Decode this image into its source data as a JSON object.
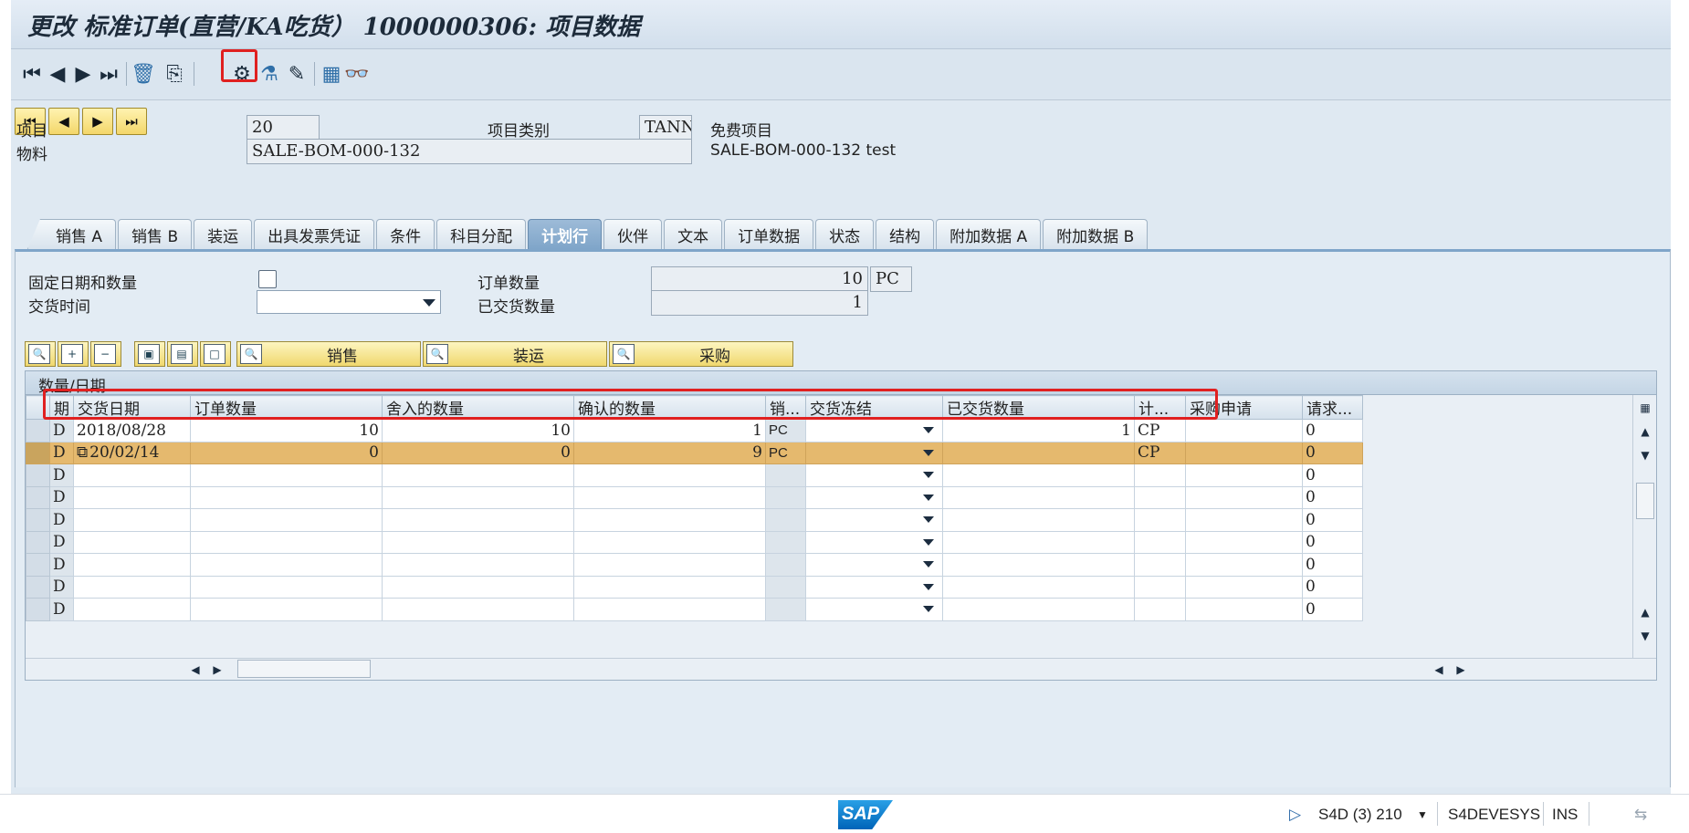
{
  "window": {
    "title": "更改 标准订单(直营/KA吃货） 1000000306: 项目数据"
  },
  "toolbar": {
    "buttons": [
      {
        "name": "first-icon",
        "glyph": "⏮"
      },
      {
        "name": "previous-icon",
        "glyph": "◀"
      },
      {
        "name": "next-icon",
        "glyph": "▶"
      },
      {
        "name": "last-icon",
        "glyph": "⏭"
      },
      {
        "name": "delete-icon",
        "glyph": "🗑"
      },
      {
        "name": "copy-icon",
        "glyph": "⎘"
      },
      {
        "name": "configuration-icon",
        "glyph": "⚙"
      },
      {
        "name": "test-icon",
        "glyph": "⚗"
      },
      {
        "name": "edit-icon",
        "glyph": "✎"
      },
      {
        "name": "calculator-icon",
        "glyph": "▦"
      },
      {
        "name": "display-icon",
        "glyph": "👓"
      }
    ]
  },
  "item_nav": [
    "⏮",
    "◀",
    "▶",
    "⏭"
  ],
  "header": {
    "item_label": "项目",
    "item_value": "20",
    "item_category_label": "项目类别",
    "item_category_value": "TANN",
    "item_category_text": "免费项目",
    "material_label": "物料",
    "material_value": "SALE-BOM-000-132",
    "material_text": "SALE-BOM-000-132 test"
  },
  "tabs": [
    {
      "label": "销售 A",
      "active": false
    },
    {
      "label": "销售 B",
      "active": false
    },
    {
      "label": "装运",
      "active": false
    },
    {
      "label": "出具发票凭证",
      "active": false
    },
    {
      "label": "条件",
      "active": false
    },
    {
      "label": "科目分配",
      "active": false
    },
    {
      "label": "计划行",
      "active": true
    },
    {
      "label": "伙伴",
      "active": false
    },
    {
      "label": "文本",
      "active": false
    },
    {
      "label": "订单数据",
      "active": false
    },
    {
      "label": "状态",
      "active": false
    },
    {
      "label": "结构",
      "active": false
    },
    {
      "label": "附加数据 A",
      "active": false
    },
    {
      "label": "附加数据 B",
      "active": false
    }
  ],
  "schedule": {
    "fixed_date_qty_label": "固定日期和数量",
    "delivery_time_label": "交货时间",
    "delivery_time_value": "",
    "order_qty_label": "订单数量",
    "order_qty_value": "10",
    "order_qty_unit": "PC",
    "delivered_qty_label": "已交货数量",
    "delivered_qty_value": "1"
  },
  "grid_buttons": {
    "sales": "销售",
    "shipping": "装运",
    "purchasing": "采购"
  },
  "grid": {
    "title": "数量/日期",
    "columns": [
      "期",
      "交货日期",
      "订单数量",
      "舍入的数量",
      "确认的数量",
      "销...",
      "交货冻结",
      "已交货数量",
      "计...",
      "采购申请",
      "请求..."
    ],
    "rows": [
      {
        "type": "D",
        "date": "2018/08/28",
        "order_qty": "10",
        "rounded_qty": "10",
        "confirmed_qty": "1",
        "unit": "PC",
        "block": "",
        "delivered_qty": "1",
        "plan": "CP",
        "preq": "",
        "req": "0"
      },
      {
        "type": "D",
        "date": "20/02/14",
        "order_qty": "0",
        "rounded_qty": "0",
        "confirmed_qty": "9",
        "unit": "PC",
        "block": "",
        "delivered_qty": "",
        "plan": "CP",
        "preq": "",
        "req": "0"
      },
      {
        "type": "D",
        "date": "",
        "order_qty": "",
        "rounded_qty": "",
        "confirmed_qty": "",
        "unit": "",
        "block": "",
        "delivered_qty": "",
        "plan": "",
        "preq": "",
        "req": "0"
      },
      {
        "type": "D",
        "date": "",
        "order_qty": "",
        "rounded_qty": "",
        "confirmed_qty": "",
        "unit": "",
        "block": "",
        "delivered_qty": "",
        "plan": "",
        "preq": "",
        "req": "0"
      },
      {
        "type": "D",
        "date": "",
        "order_qty": "",
        "rounded_qty": "",
        "confirmed_qty": "",
        "unit": "",
        "block": "",
        "delivered_qty": "",
        "plan": "",
        "preq": "",
        "req": "0"
      },
      {
        "type": "D",
        "date": "",
        "order_qty": "",
        "rounded_qty": "",
        "confirmed_qty": "",
        "unit": "",
        "block": "",
        "delivered_qty": "",
        "plan": "",
        "preq": "",
        "req": "0"
      },
      {
        "type": "D",
        "date": "",
        "order_qty": "",
        "rounded_qty": "",
        "confirmed_qty": "",
        "unit": "",
        "block": "",
        "delivered_qty": "",
        "plan": "",
        "preq": "",
        "req": "0"
      },
      {
        "type": "D",
        "date": "",
        "order_qty": "",
        "rounded_qty": "",
        "confirmed_qty": "",
        "unit": "",
        "block": "",
        "delivered_qty": "",
        "plan": "",
        "preq": "",
        "req": "0"
      },
      {
        "type": "D",
        "date": "",
        "order_qty": "",
        "rounded_qty": "",
        "confirmed_qty": "",
        "unit": "",
        "block": "",
        "delivered_qty": "",
        "plan": "",
        "preq": "",
        "req": "0"
      }
    ]
  },
  "status_bar": {
    "logo": "SAP",
    "system": "S4D (3) 210",
    "server": "S4DEVESYS",
    "mode": "INS"
  },
  "colors": {
    "highlight_row": "#e5b96e",
    "annotation_box": "#e02020",
    "active_tab": "#7fa5c9"
  }
}
